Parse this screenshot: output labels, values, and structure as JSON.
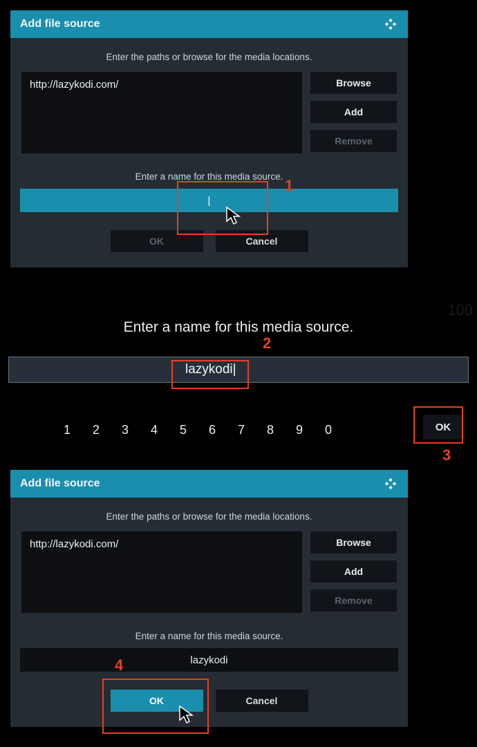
{
  "dialog1": {
    "title": "Add file source",
    "instruction": "Enter the paths or browse for the media locations.",
    "path": "http://lazykodi.com/",
    "browse": "Browse",
    "add": "Add",
    "remove": "Remove",
    "name_label": "Enter a name for this media source.",
    "name_value": "|",
    "ok": "OK",
    "cancel": "Cancel"
  },
  "step2": {
    "title": "Enter a name for this media source.",
    "input": "lazykodi|",
    "keys": [
      "1",
      "2",
      "3",
      "4",
      "5",
      "6",
      "7",
      "8",
      "9",
      "0"
    ],
    "ok": "OK"
  },
  "dialog2": {
    "title": "Add file source",
    "instruction": "Enter the paths or browse for the media locations.",
    "path": "http://lazykodi.com/",
    "browse": "Browse",
    "add": "Add",
    "remove": "Remove",
    "name_label": "Enter a name for this media source.",
    "name_value": "lazykodi",
    "ok": "OK",
    "cancel": "Cancel"
  },
  "annotations": {
    "n1": "1",
    "n2": "2",
    "n3": "3",
    "n4": "4"
  },
  "page_number": "100"
}
